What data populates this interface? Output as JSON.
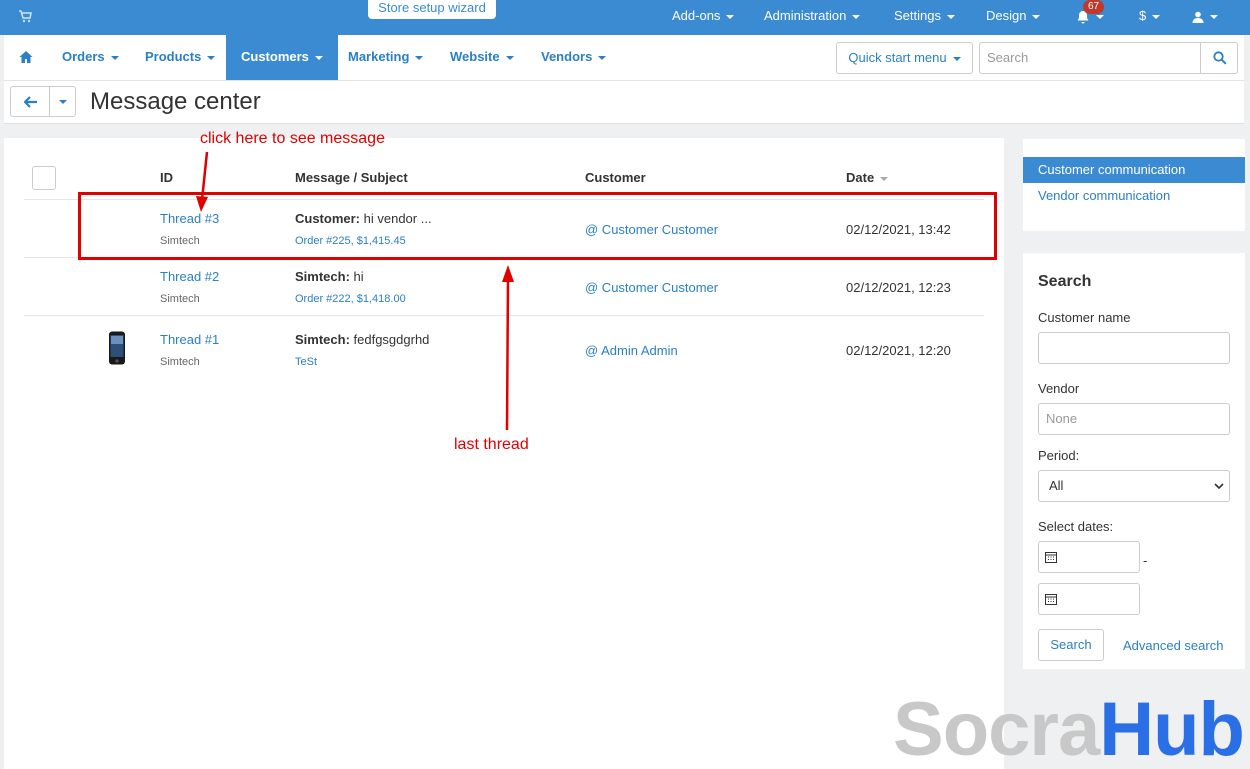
{
  "topbar": {
    "wizard_label": "Store setup wizard",
    "menus": [
      "Add-ons",
      "Administration",
      "Settings",
      "Design"
    ],
    "notification_count": "67",
    "currency": "$"
  },
  "nav": {
    "items": [
      "Orders",
      "Products",
      "Customers",
      "Marketing",
      "Website",
      "Vendors"
    ],
    "active": "Customers",
    "quick_start": "Quick start menu",
    "search_placeholder": "Search"
  },
  "page": {
    "title": "Message center"
  },
  "table": {
    "headers": {
      "id": "ID",
      "message": "Message / Subject",
      "customer": "Customer",
      "date": "Date"
    },
    "rows": [
      {
        "thread": "Thread #3",
        "company": "Simtech",
        "author": "Customer:",
        "message": " hi vendor ...",
        "sub": "Order #225, $1,415.45",
        "customer": "@ Customer Customer",
        "date": "02/12/2021, 13:42"
      },
      {
        "thread": "Thread #2",
        "company": "Simtech",
        "author": "Simtech:",
        "message": " hi",
        "sub": "Order #222, $1,418.00",
        "customer": "@ Customer Customer",
        "date": "02/12/2021, 12:23"
      },
      {
        "thread": "Thread #1",
        "company": "Simtech",
        "author": "Simtech:",
        "message": " fedfgsgdgrhd",
        "sub": "TeSt",
        "customer": "@ Admin Admin",
        "date": "02/12/2021, 12:20"
      }
    ]
  },
  "annotations": {
    "click_hint": "click here to see message",
    "last_thread": "last thread"
  },
  "sidebar": {
    "items": [
      "Customer communication",
      "Vendor communication"
    ],
    "search": {
      "title": "Search",
      "customer_name_label": "Customer name",
      "vendor_label": "Vendor",
      "vendor_placeholder": "None",
      "period_label": "Period:",
      "period_value": "All",
      "dates_label": "Select dates:",
      "date_separator": "-",
      "search_button": "Search",
      "advanced_link": "Advanced search"
    }
  },
  "watermark": {
    "part1": "Socra",
    "part2": "Hub"
  },
  "colors": {
    "accent": "#3a8bd1",
    "annotation": "#e00000"
  }
}
